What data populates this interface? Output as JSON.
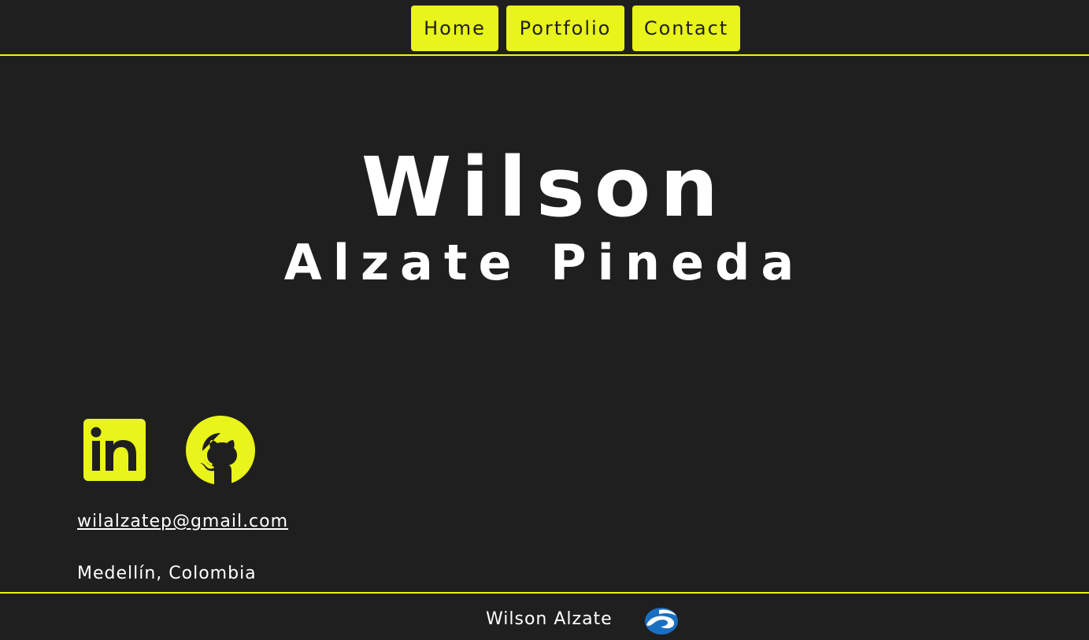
{
  "nav": {
    "items": [
      {
        "label": "Home"
      },
      {
        "label": "Portfolio"
      },
      {
        "label": "Contact"
      }
    ]
  },
  "hero": {
    "first_name": "Wilson",
    "last_name": "Alzate Pineda"
  },
  "social": {
    "linkedin_icon": "linkedin-icon",
    "github_icon": "github-icon"
  },
  "contact": {
    "email": "wilalzatep@gmail.com",
    "location": "Medellín, Colombia"
  },
  "footer": {
    "name": "Wilson Alzate",
    "logo_icon": "blue-swirl-logo-icon"
  },
  "colors": {
    "background": "#201f20",
    "accent": "#e9f41a",
    "text": "#ffffff",
    "logo_blue": "#1a6fc0"
  }
}
